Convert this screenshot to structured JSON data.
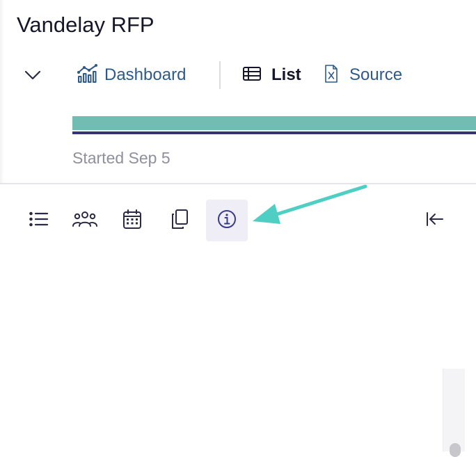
{
  "header": {
    "title": "Vandelay RFP",
    "tabs": [
      {
        "label": "Dashboard",
        "icon": "chart-icon"
      },
      {
        "label": "List",
        "icon": "table-icon",
        "active": true
      },
      {
        "label": "Source",
        "icon": "excel-file-icon"
      }
    ],
    "collapse_icon": "chevron-down-icon"
  },
  "progress": {
    "status_text": "Started Sep 5",
    "colors": {
      "primary": "#72bdb3",
      "secondary": "#343476"
    }
  },
  "toolbar": {
    "items": [
      {
        "icon": "list-icon"
      },
      {
        "icon": "people-icon"
      },
      {
        "icon": "calendar-icon"
      },
      {
        "icon": "copy-icon"
      },
      {
        "icon": "info-icon",
        "active": true
      }
    ],
    "collapse_icon": "collapse-left-icon"
  },
  "annotation": {
    "color": "#4fcec4",
    "points_to": "info-icon"
  },
  "colors": {
    "link": "#2d5a8a",
    "text": "#16162a",
    "muted": "#8f8f9d",
    "icon": "#2a2a44",
    "active_bg": "#efeef7"
  }
}
